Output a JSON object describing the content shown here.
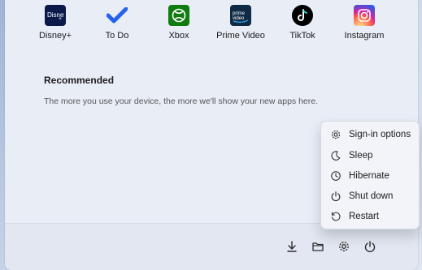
{
  "pinned_apps": [
    {
      "label": "Disney+",
      "icon": "disney-plus-icon"
    },
    {
      "label": "To Do",
      "icon": "todo-check-icon"
    },
    {
      "label": "Xbox",
      "icon": "xbox-icon"
    },
    {
      "label": "Prime Video",
      "icon": "prime-video-icon"
    },
    {
      "label": "TikTok",
      "icon": "tiktok-icon"
    },
    {
      "label": "Instagram",
      "icon": "instagram-icon"
    }
  ],
  "recommended": {
    "title": "Recommended",
    "empty_text": "The more you use your device, the more we'll show your new apps here."
  },
  "power_menu": {
    "items": [
      {
        "label": "Sign-in options",
        "icon": "gear-icon"
      },
      {
        "label": "Sleep",
        "icon": "moon-icon"
      },
      {
        "label": "Hibernate",
        "icon": "clock-icon"
      },
      {
        "label": "Shut down",
        "icon": "power-icon"
      },
      {
        "label": "Restart",
        "icon": "restart-icon"
      }
    ]
  },
  "footer_icons": [
    "download-icon",
    "folder-icon",
    "gear-icon",
    "power-icon"
  ],
  "colors": {
    "disney_bg": "#0b1a4a",
    "todo_blue": "#3b82f6",
    "xbox_green": "#107c10",
    "prime_bg": "#0f2a44",
    "tiktok_bg": "#000000"
  }
}
